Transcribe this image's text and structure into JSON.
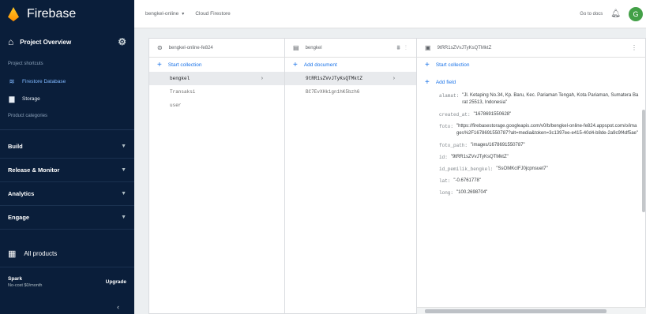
{
  "app": {
    "brand": "Firebase"
  },
  "sidebar": {
    "project_overview": "Project Overview",
    "shortcuts_label": "Project shortcuts",
    "items": [
      {
        "label": "Firestore Database",
        "active": true
      },
      {
        "label": "Storage",
        "active": false
      }
    ],
    "categories_label": "Product categories",
    "groups": [
      "Build",
      "Release & Monitor",
      "Analytics",
      "Engage"
    ],
    "all_products": "All products",
    "plan_name": "Spark",
    "plan_desc": "No-cost $0/month",
    "upgrade": "Upgrade"
  },
  "topbar": {
    "project": "bengkel-online",
    "product": "Cloud Firestore",
    "goto_docs": "Go to docs",
    "avatar_letter": "G"
  },
  "panels": {
    "root": {
      "title": "bengkel-online-fe824",
      "action": "Start collection",
      "collections": [
        {
          "name": "bengkel",
          "selected": true
        },
        {
          "name": "Transaksi",
          "selected": false
        },
        {
          "name": "user",
          "selected": false
        }
      ]
    },
    "collection": {
      "title": "bengkel",
      "action": "Add document",
      "documents": [
        {
          "id": "9tRR1sZVvJTyKsQTMktZ",
          "selected": true
        },
        {
          "id": "BC7EvXHk1gn1hK5bzh6",
          "selected": false
        }
      ]
    },
    "document": {
      "title": "9tRR1sZVvJTyKsQTMktZ",
      "action1": "Start collection",
      "action2": "Add field",
      "fields": [
        {
          "key": "alamat:",
          "value": "\"Jl. Ketaping No.34, Kp. Baru, Kec. Pariaman Tengah, Kota Pariaman, Sumatera Barat 25513, Indonesia\""
        },
        {
          "key": "created_at:",
          "value": "\"1678691550628\""
        },
        {
          "key": "foto:",
          "value": "\"https://firebasestorage.googleapis.com/v0/b/bengkel-online-fe824.appspot.com/o/images%2F1678691550787?alt=media&token=3c1397ee-e415-40d4-b8de-2a9c9f4df5ae\""
        },
        {
          "key": "foto_path:",
          "value": "\"images/1678691550787\""
        },
        {
          "key": "id:",
          "value": "\"9tRR1sZVvJTyKsQTMktZ\""
        },
        {
          "key": "id_pemilik_bengkel:",
          "value": "\"SsOMKcIFJ0jcpnsuet7\""
        },
        {
          "key": "lat:",
          "value": "\"-0.6761778\""
        },
        {
          "key": "long:",
          "value": "\"100.2698704\""
        }
      ]
    }
  }
}
